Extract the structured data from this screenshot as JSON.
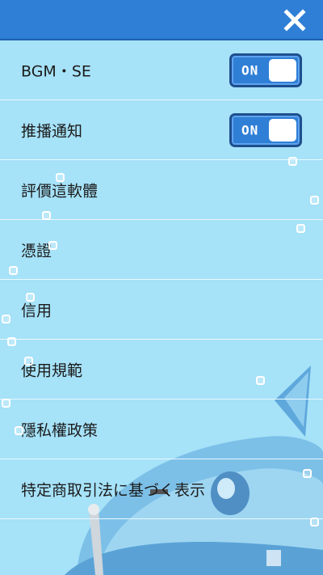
{
  "header": {
    "close_icon": "close-icon"
  },
  "settings": [
    {
      "label": "BGM・SE",
      "toggle": "ON"
    },
    {
      "label": "推播通知",
      "toggle": "ON"
    }
  ],
  "links": [
    {
      "label": "評價這軟體"
    },
    {
      "label": "憑證"
    },
    {
      "label": "信用"
    },
    {
      "label": "使用規範"
    },
    {
      "label": "隱私權政策"
    },
    {
      "label": "特定商取引法に基づく表示"
    }
  ],
  "colors": {
    "header": "#2f7fd6",
    "background": "#a6e2f8",
    "toggle_on": "#2f7fd6"
  }
}
